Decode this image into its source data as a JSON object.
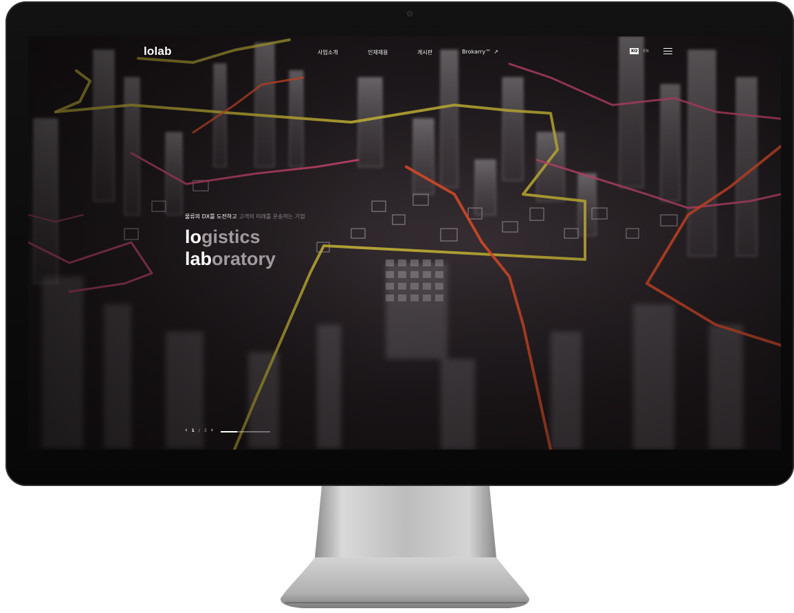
{
  "header": {
    "logo": "lolab",
    "nav": [
      {
        "label": "사업소개"
      },
      {
        "label": "인재채용"
      },
      {
        "label": "게시판"
      },
      {
        "label": "Brokarry™",
        "arrow": "↗"
      }
    ],
    "lang": {
      "ko": "KO",
      "en": "EN"
    },
    "menu_icon": "hamburger-icon"
  },
  "hero": {
    "tagline_bright": "물류의 DX를 도전하고",
    "tagline_dim": "고객의 미래를 운송하는 기업",
    "title_line1_bold": "lo",
    "title_line1_rest": "gistics",
    "title_line2_bold": "lab",
    "title_line2_rest": "oratory"
  },
  "slider": {
    "prev_icon": "‹",
    "next_icon": "›",
    "current": "1",
    "separator": "/",
    "total": "3",
    "progress": 0.33
  },
  "colors": {
    "route_yellow": "#d7c43a",
    "route_pink": "#d84a78",
    "route_orange": "#e8502a",
    "bezel": "#0b0b0b"
  }
}
